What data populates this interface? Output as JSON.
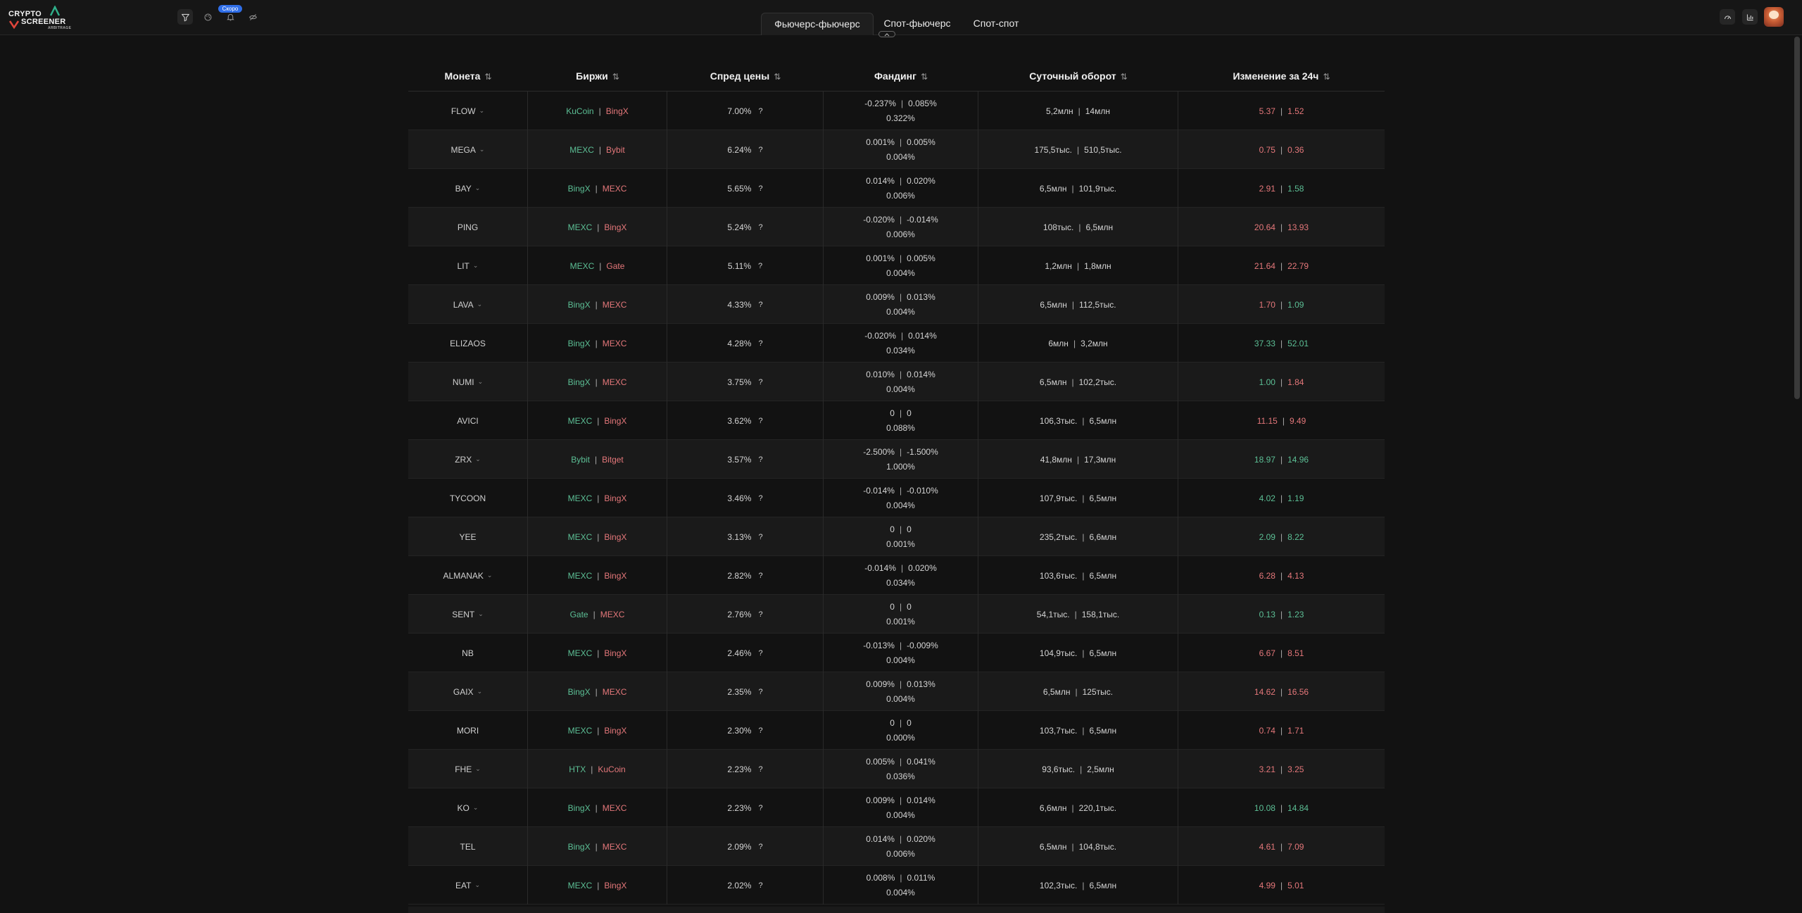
{
  "header": {
    "logo": {
      "line1": "CRYPTO",
      "line2": "SCREENER",
      "line3": "ARBITRAGE"
    },
    "soon_badge": "Скоро",
    "tabs": [
      {
        "label": "Фьючерс-фьючерс",
        "active": true
      },
      {
        "label": "Спот-фьючерс",
        "active": false
      },
      {
        "label": "Спот-спот",
        "active": false
      }
    ]
  },
  "colors": {
    "green": "#5cbf95",
    "red": "#e4777a",
    "accent": "#2f6ee8"
  },
  "table": {
    "columns": [
      {
        "label": "Монета",
        "sort": "⇅"
      },
      {
        "label": "Биржи",
        "sort": "⇅"
      },
      {
        "label": "Спред цены",
        "sort": "⇅"
      },
      {
        "label": "Фандинг",
        "sort": "⇅"
      },
      {
        "label": "Суточный оборот",
        "sort": "⇅"
      },
      {
        "label": "Изменение за 24ч",
        "sort": "⇅"
      }
    ],
    "rows": [
      {
        "coin": "FLOW",
        "ex1": "KuCoin",
        "ex2": "BingX",
        "spread": "7.00%",
        "f1": "-0.237%",
        "f2": "0.085%",
        "f3": "0.322%",
        "v1": "5,2млн",
        "v2": "14млн",
        "c1": "5.37",
        "c2": "1.52",
        "c1c": "red",
        "c2c": "red",
        "chev": true
      },
      {
        "coin": "MEGA",
        "ex1": "MEXC",
        "ex2": "Bybit",
        "spread": "6.24%",
        "f1": "0.001%",
        "f2": "0.005%",
        "f3": "0.004%",
        "v1": "175,5тыс.",
        "v2": "510,5тыс.",
        "c1": "0.75",
        "c2": "0.36",
        "c1c": "red",
        "c2c": "red",
        "chev": true
      },
      {
        "coin": "BAY",
        "ex1": "BingX",
        "ex2": "MEXC",
        "spread": "5.65%",
        "f1": "0.014%",
        "f2": "0.020%",
        "f3": "0.006%",
        "v1": "6,5млн",
        "v2": "101,9тыс.",
        "c1": "2.91",
        "c2": "1.58",
        "c1c": "red",
        "c2c": "green",
        "chev": true
      },
      {
        "coin": "PING",
        "ex1": "MEXC",
        "ex2": "BingX",
        "spread": "5.24%",
        "f1": "-0.020%",
        "f2": "-0.014%",
        "f3": "0.006%",
        "v1": "108тыс.",
        "v2": "6,5млн",
        "c1": "20.64",
        "c2": "13.93",
        "c1c": "red",
        "c2c": "red",
        "chev": false
      },
      {
        "coin": "LIT",
        "ex1": "MEXC",
        "ex2": "Gate",
        "spread": "5.11%",
        "f1": "0.001%",
        "f2": "0.005%",
        "f3": "0.004%",
        "v1": "1,2млн",
        "v2": "1,8млн",
        "c1": "21.64",
        "c2": "22.79",
        "c1c": "red",
        "c2c": "red",
        "chev": true
      },
      {
        "coin": "LAVA",
        "ex1": "BingX",
        "ex2": "MEXC",
        "spread": "4.33%",
        "f1": "0.009%",
        "f2": "0.013%",
        "f3": "0.004%",
        "v1": "6,5млн",
        "v2": "112,5тыс.",
        "c1": "1.70",
        "c2": "1.09",
        "c1c": "red",
        "c2c": "green",
        "chev": true
      },
      {
        "coin": "ELIZAOS",
        "ex1": "BingX",
        "ex2": "MEXC",
        "spread": "4.28%",
        "f1": "-0.020%",
        "f2": "0.014%",
        "f3": "0.034%",
        "v1": "6млн",
        "v2": "3,2млн",
        "c1": "37.33",
        "c2": "52.01",
        "c1c": "green",
        "c2c": "green",
        "chev": false
      },
      {
        "coin": "NUMI",
        "ex1": "BingX",
        "ex2": "MEXC",
        "spread": "3.75%",
        "f1": "0.010%",
        "f2": "0.014%",
        "f3": "0.004%",
        "v1": "6,5млн",
        "v2": "102,2тыс.",
        "c1": "1.00",
        "c2": "1.84",
        "c1c": "green",
        "c2c": "red",
        "chev": true
      },
      {
        "coin": "AVICI",
        "ex1": "MEXC",
        "ex2": "BingX",
        "spread": "3.62%",
        "f1": "0",
        "f2": "0",
        "f3": "0.088%",
        "v1": "106,3тыс.",
        "v2": "6,5млн",
        "c1": "11.15",
        "c2": "9.49",
        "c1c": "red",
        "c2c": "red",
        "chev": false
      },
      {
        "coin": "ZRX",
        "ex1": "Bybit",
        "ex2": "Bitget",
        "spread": "3.57%",
        "f1": "-2.500%",
        "f2": "-1.500%",
        "f3": "1.000%",
        "v1": "41,8млн",
        "v2": "17,3млн",
        "c1": "18.97",
        "c2": "14.96",
        "c1c": "green",
        "c2c": "green",
        "chev": true
      },
      {
        "coin": "TYCOON",
        "ex1": "MEXC",
        "ex2": "BingX",
        "spread": "3.46%",
        "f1": "-0.014%",
        "f2": "-0.010%",
        "f3": "0.004%",
        "v1": "107,9тыс.",
        "v2": "6,5млн",
        "c1": "4.02",
        "c2": "1.19",
        "c1c": "green",
        "c2c": "green",
        "chev": false
      },
      {
        "coin": "YEE",
        "ex1": "MEXC",
        "ex2": "BingX",
        "spread": "3.13%",
        "f1": "0",
        "f2": "0",
        "f3": "0.001%",
        "v1": "235,2тыс.",
        "v2": "6,6млн",
        "c1": "2.09",
        "c2": "8.22",
        "c1c": "green",
        "c2c": "green",
        "chev": false
      },
      {
        "coin": "ALMANAK",
        "ex1": "MEXC",
        "ex2": "BingX",
        "spread": "2.82%",
        "f1": "-0.014%",
        "f2": "0.020%",
        "f3": "0.034%",
        "v1": "103,6тыс.",
        "v2": "6,5млн",
        "c1": "6.28",
        "c2": "4.13",
        "c1c": "red",
        "c2c": "red",
        "chev": true
      },
      {
        "coin": "SENT",
        "ex1": "Gate",
        "ex2": "MEXC",
        "spread": "2.76%",
        "f1": "0",
        "f2": "0",
        "f3": "0.001%",
        "v1": "54,1тыс.",
        "v2": "158,1тыс.",
        "c1": "0.13",
        "c2": "1.23",
        "c1c": "green",
        "c2c": "green",
        "chev": true
      },
      {
        "coin": "NB",
        "ex1": "MEXC",
        "ex2": "BingX",
        "spread": "2.46%",
        "f1": "-0.013%",
        "f2": "-0.009%",
        "f3": "0.004%",
        "v1": "104,9тыс.",
        "v2": "6,5млн",
        "c1": "6.67",
        "c2": "8.51",
        "c1c": "red",
        "c2c": "red",
        "chev": false
      },
      {
        "coin": "GAIX",
        "ex1": "BingX",
        "ex2": "MEXC",
        "spread": "2.35%",
        "f1": "0.009%",
        "f2": "0.013%",
        "f3": "0.004%",
        "v1": "6,5млн",
        "v2": "125тыс.",
        "c1": "14.62",
        "c2": "16.56",
        "c1c": "red",
        "c2c": "red",
        "chev": true
      },
      {
        "coin": "MORI",
        "ex1": "MEXC",
        "ex2": "BingX",
        "spread": "2.30%",
        "f1": "0",
        "f2": "0",
        "f3": "0.000%",
        "v1": "103,7тыс.",
        "v2": "6,5млн",
        "c1": "0.74",
        "c2": "1.71",
        "c1c": "red",
        "c2c": "red",
        "chev": false
      },
      {
        "coin": "FHE",
        "ex1": "HTX",
        "ex2": "KuCoin",
        "spread": "2.23%",
        "f1": "0.005%",
        "f2": "0.041%",
        "f3": "0.036%",
        "v1": "93,6тыс.",
        "v2": "2,5млн",
        "c1": "3.21",
        "c2": "3.25",
        "c1c": "red",
        "c2c": "red",
        "chev": true
      },
      {
        "coin": "KO",
        "ex1": "BingX",
        "ex2": "MEXC",
        "spread": "2.23%",
        "f1": "0.009%",
        "f2": "0.014%",
        "f3": "0.004%",
        "v1": "6,6млн",
        "v2": "220,1тыс.",
        "c1": "10.08",
        "c2": "14.84",
        "c1c": "green",
        "c2c": "green",
        "chev": true
      },
      {
        "coin": "TEL",
        "ex1": "BingX",
        "ex2": "MEXC",
        "spread": "2.09%",
        "f1": "0.014%",
        "f2": "0.020%",
        "f3": "0.006%",
        "v1": "6,5млн",
        "v2": "104,8тыс.",
        "c1": "4.61",
        "c2": "7.09",
        "c1c": "red",
        "c2c": "red",
        "chev": false
      },
      {
        "coin": "EAT",
        "ex1": "MEXC",
        "ex2": "BingX",
        "spread": "2.02%",
        "f1": "0.008%",
        "f2": "0.011%",
        "f3": "0.004%",
        "v1": "102,3тыс.",
        "v2": "6,5млн",
        "c1": "4.99",
        "c2": "5.01",
        "c1c": "red",
        "c2c": "red",
        "chev": true
      }
    ]
  }
}
